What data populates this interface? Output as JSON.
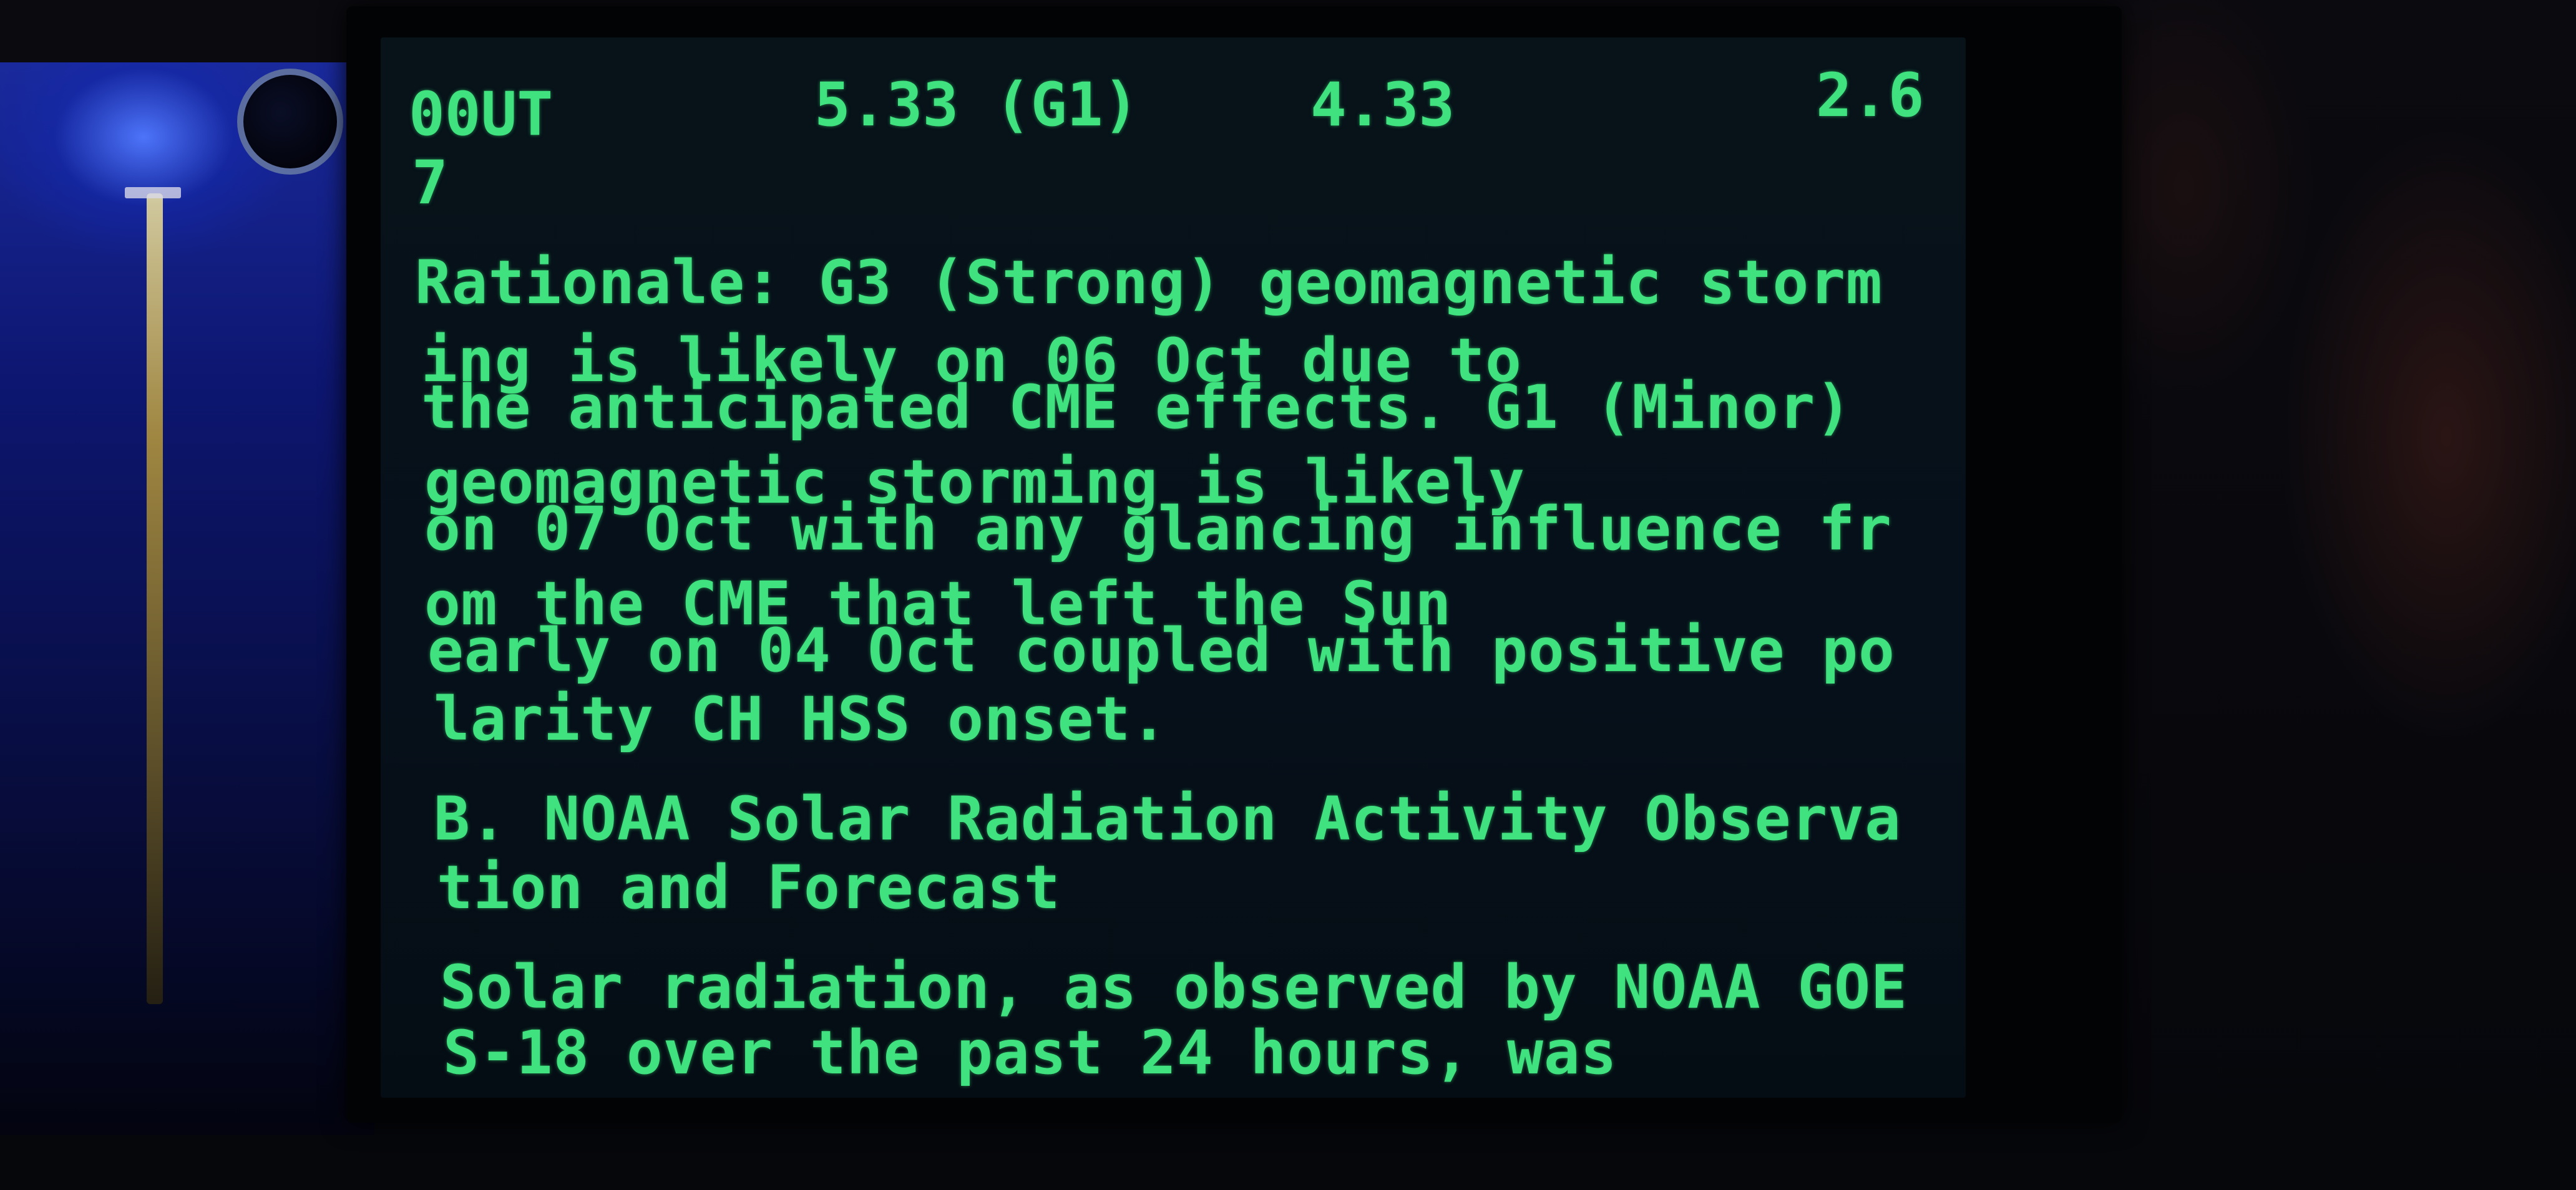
{
  "screen": {
    "table_row": {
      "label": "00UT",
      "value_1": "5.33 (G1)",
      "value_2": "4.33",
      "value_3": "2.6",
      "wrap": "7"
    },
    "lines": [
      "Rationale: G3 (Strong) geomagnetic storm",
      "ing is likely on 06 Oct due to",
      "the anticipated CME effects. G1 (Minor)",
      "geomagnetic storming is likely",
      "on 07 Oct with any glancing influence fr",
      "om the CME that left the Sun",
      "early on 04 Oct coupled with positive po",
      "larity CH HSS onset.",
      "B. NOAA Solar Radiation Activity Observa",
      "tion and Forecast",
      "Solar radiation, as observed by NOAA GOE",
      "S-18 over the past 24 hours, was"
    ],
    "text_color": "#3fe27e",
    "background_color": "#06101a"
  }
}
